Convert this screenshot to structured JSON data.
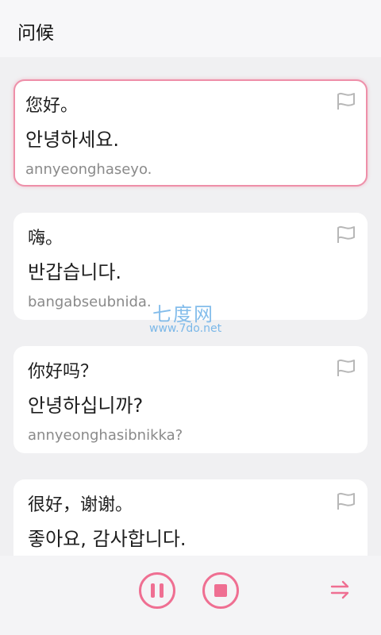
{
  "header": {
    "title": "问候"
  },
  "phrases": [
    {
      "zh": "您好。",
      "ko": "안녕하세요.",
      "rom": "annyeonghaseyo.",
      "selected": true
    },
    {
      "zh": "嗨。",
      "ko": "반갑습니다.",
      "rom": "bangabseubnida.",
      "selected": false
    },
    {
      "zh": "你好吗？",
      "ko": "안녕하십니까?",
      "rom": "annyeonghasibnikka?",
      "selected": false
    },
    {
      "zh": "很好，谢谢。",
      "ko": "좋아요, 감사합니다.",
      "rom": "",
      "selected": false
    }
  ],
  "watermark": {
    "main": "七度网",
    "url": "www.7do.net"
  },
  "player": {
    "accent": "#ef6f92",
    "controls": [
      "pause-icon",
      "stop-icon",
      "play-order-icon"
    ]
  },
  "colors": {
    "selected_border": "#ee8fa9",
    "flag": "#b7b7b7"
  }
}
